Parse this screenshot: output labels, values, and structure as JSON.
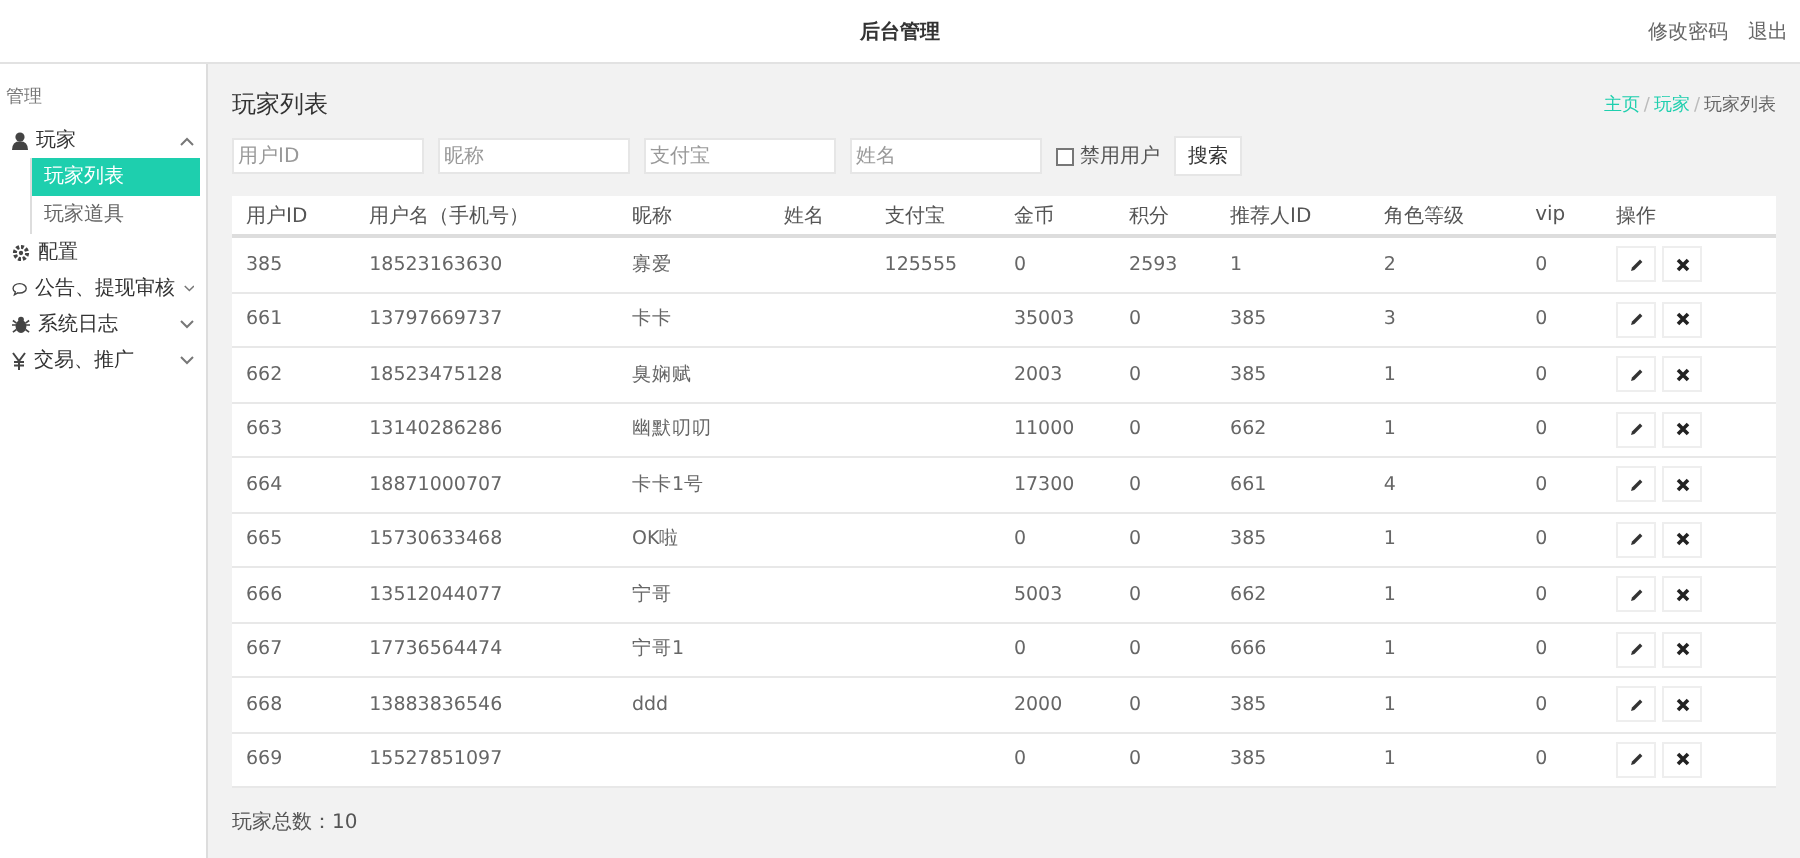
{
  "header": {
    "title": "后台管理",
    "links": [
      "修改密码",
      "退出"
    ]
  },
  "sidebar": {
    "heading": "管理",
    "items": [
      {
        "label": "玩家",
        "expanded": true,
        "children": [
          {
            "label": "玩家列表",
            "selected": true
          },
          {
            "label": "玩家道具",
            "selected": false
          }
        ]
      },
      {
        "label": "配置"
      },
      {
        "label": "公告、提现审核",
        "expanded": false
      },
      {
        "label": "系统日志",
        "expanded": false
      },
      {
        "label": "交易、推广",
        "expanded": false
      }
    ]
  },
  "page_title": "玩家列表",
  "breadcrumb": {
    "separator": "/",
    "items": [
      {
        "label": "主页",
        "link": true
      },
      {
        "label": "玩家",
        "link": true
      },
      {
        "label": "玩家列表",
        "link": false
      }
    ]
  },
  "filters": {
    "fields": [
      {
        "placeholder": "用户ID"
      },
      {
        "placeholder": "昵称"
      },
      {
        "placeholder": "支付宝"
      },
      {
        "placeholder": "姓名"
      }
    ],
    "checkbox": {
      "label": "禁用用户",
      "checked": false
    },
    "button": "搜索"
  },
  "table": {
    "columns": [
      "用户ID",
      "用户名（手机号）",
      "昵称",
      "姓名",
      "支付宝",
      "金币",
      "积分",
      "推荐人ID",
      "角色等级",
      "vip",
      "操作"
    ],
    "rows": [
      [
        "385",
        "18523163630",
        "寡爱",
        "",
        "125555",
        "0",
        "2593",
        "1",
        "2",
        "0"
      ],
      [
        "661",
        "13797669737",
        "卡卡",
        "",
        "",
        "35003",
        "0",
        "385",
        "3",
        "0"
      ],
      [
        "662",
        "18523475128",
        "臭娴赋",
        "",
        "",
        "2003",
        "0",
        "385",
        "1",
        "0"
      ],
      [
        "663",
        "13140286286",
        "幽默叨叨",
        "",
        "",
        "11000",
        "0",
        "662",
        "1",
        "0"
      ],
      [
        "664",
        "18871000707",
        "卡卡1号",
        "",
        "",
        "17300",
        "0",
        "661",
        "4",
        "0"
      ],
      [
        "665",
        "15730633468",
        "OK啦",
        "",
        "",
        "0",
        "0",
        "385",
        "1",
        "0"
      ],
      [
        "666",
        "13512044077",
        "宁哥",
        "",
        "",
        "5003",
        "0",
        "662",
        "1",
        "0"
      ],
      [
        "667",
        "17736564474",
        "宁哥1",
        "",
        "",
        "0",
        "0",
        "666",
        "1",
        "0"
      ],
      [
        "668",
        "13883836546",
        "ddd",
        "",
        "",
        "2000",
        "0",
        "385",
        "1",
        "0"
      ],
      [
        "669",
        "15527851097",
        "",
        "",
        "",
        "0",
        "0",
        "385",
        "1",
        "0"
      ]
    ]
  },
  "total": "玩家总数：10"
}
